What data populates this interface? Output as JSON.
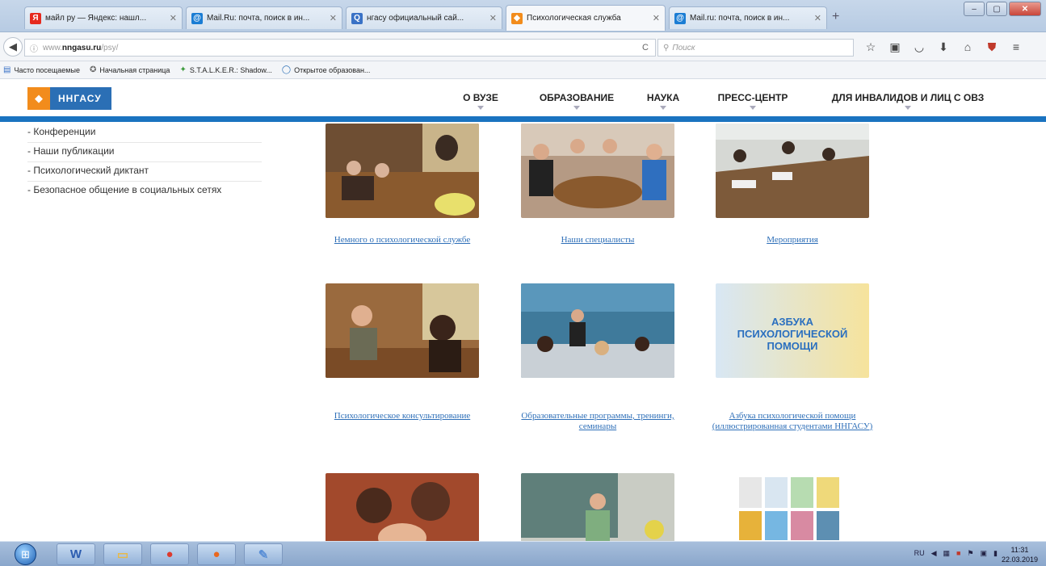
{
  "tabs": [
    {
      "label": "майл ру — Яндекс: нашл...",
      "icon": "yandex-icon",
      "color": "#e62a1e",
      "glyph": "Я"
    },
    {
      "label": "Mail.Ru: почта, поиск в ин...",
      "icon": "mailru-icon",
      "color": "#1b7dd4",
      "glyph": "@"
    },
    {
      "label": "нгасу официальный сай...",
      "icon": "search-icon",
      "color": "#3a72c6",
      "glyph": "Q"
    },
    {
      "label": "Психологическая служба",
      "icon": "site-favicon-icon",
      "color": "#f28c1c",
      "glyph": "◆"
    },
    {
      "label": "Mail.ru: почта, поиск в ин...",
      "icon": "mailru-icon",
      "color": "#1b7dd4",
      "glyph": "@"
    }
  ],
  "browser": {
    "url_prefix": "www.",
    "url_host": "nngasu.ru",
    "url_path": "/psy/",
    "search_placeholder": "Поиск",
    "reload_glyph": "C"
  },
  "bookmarks": [
    {
      "label": "Часто посещаемые",
      "icon": "bookmarks-folder-icon",
      "glyph": "▤"
    },
    {
      "label": "Начальная страница",
      "icon": "home-page-icon",
      "glyph": "✪"
    },
    {
      "label": "S.T.A.L.K.E.R.: Shadow...",
      "icon": "stalker-icon",
      "glyph": "✦"
    },
    {
      "label": "Открытое образован...",
      "icon": "open-education-icon",
      "glyph": "◯"
    }
  ],
  "site": {
    "logo_text": "ННГАСУ",
    "menu": [
      {
        "label": "О ВУЗЕ"
      },
      {
        "label": "ОБРАЗОВАНИЕ"
      },
      {
        "label": "НАУКА"
      },
      {
        "label": "ПРЕСС-ЦЕНТР"
      },
      {
        "label": "ДЛЯ ИНВАЛИДОВ И ЛИЦ С ОВЗ"
      }
    ],
    "sidebar": [
      {
        "label": "- Конференции"
      },
      {
        "label": "- Наши публикации"
      },
      {
        "label": "- Психологический диктант"
      },
      {
        "label": "- Безопасное общение в социальных сетях"
      }
    ],
    "tiles": [
      {
        "caption": "Немного о психологической службе",
        "theme": "#7a5a3c"
      },
      {
        "caption": "Наши специалисты",
        "theme": "#5b6b7d"
      },
      {
        "caption": "Мероприятия",
        "theme": "#8a7d6a"
      },
      {
        "caption": "Психологическое консультирование",
        "theme": "#7c5236"
      },
      {
        "caption": "Образовательные программы, тренинги, семинары",
        "theme": "#3d6f8e"
      },
      {
        "caption": "Азбука психологической помощи (иллюстрированная студентами ННГАСУ)",
        "theme": "#f5d87a",
        "banner": "АЗБУКА ПСИХОЛОГИЧЕСКОЙ ПОМОЩИ"
      },
      {
        "caption": "",
        "theme": "#a2492c"
      },
      {
        "caption": "",
        "theme": "#6f8a8c"
      },
      {
        "caption": "",
        "theme": "#e6e0cf"
      }
    ]
  },
  "taskbar": {
    "apps": [
      {
        "name": "word",
        "glyph": "W",
        "color": "#2b5cb0"
      },
      {
        "name": "folder",
        "glyph": "▭",
        "color": "#e7b949"
      },
      {
        "name": "chrome",
        "glyph": "●",
        "color": "#dd3a2e"
      },
      {
        "name": "firefox",
        "glyph": "●",
        "color": "#e9681f"
      },
      {
        "name": "paint",
        "glyph": "✎",
        "color": "#5a8fd6"
      }
    ],
    "lang": "RU",
    "time": "11:31",
    "date": "22.03.2019"
  }
}
